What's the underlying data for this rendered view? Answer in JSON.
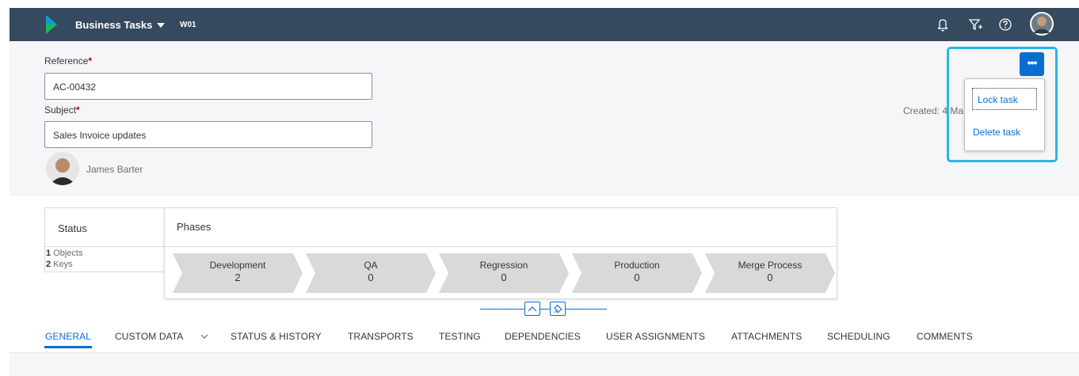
{
  "shell": {
    "app_title": "Business Tasks",
    "app_subtitle": "W01",
    "icons": [
      "bell-icon",
      "filter-add-icon",
      "help-icon"
    ]
  },
  "header": {
    "reference_label": "Reference",
    "reference_value": "AC-00432",
    "subject_label": "Subject",
    "subject_value": "Sales Invoice updates",
    "required_marker": "*",
    "person_name": "James Barter",
    "created_text": "Created: 4 Ma"
  },
  "menu": {
    "more_label": "•••",
    "items": [
      {
        "label": "Lock task"
      },
      {
        "label": "Delete task"
      }
    ]
  },
  "status": {
    "title": "Status",
    "lines": [
      {
        "count": "1",
        "label": "Objects"
      },
      {
        "count": "2",
        "label": "Keys"
      }
    ]
  },
  "phases": {
    "title": "Phases",
    "items": [
      {
        "name": "Development",
        "count": "2"
      },
      {
        "name": "QA",
        "count": "0"
      },
      {
        "name": "Regression",
        "count": "0"
      },
      {
        "name": "Production",
        "count": "0"
      },
      {
        "name": "Merge Process",
        "count": "0"
      }
    ]
  },
  "tabs": [
    {
      "label": "GENERAL"
    },
    {
      "label": "CUSTOM DATA"
    },
    {
      "label": "STATUS & HISTORY"
    },
    {
      "label": "TRANSPORTS"
    },
    {
      "label": "TESTING"
    },
    {
      "label": "DEPENDENCIES"
    },
    {
      "label": "USER ASSIGNMENTS"
    },
    {
      "label": "ATTACHMENTS"
    },
    {
      "label": "SCHEDULING"
    },
    {
      "label": "COMMENTS"
    }
  ],
  "colors": {
    "shell": "#354a5f",
    "accent": "#0a6ed1",
    "highlight": "#29b6e6",
    "required": "#bb0000",
    "phase_fill": "#d9d9d9"
  }
}
